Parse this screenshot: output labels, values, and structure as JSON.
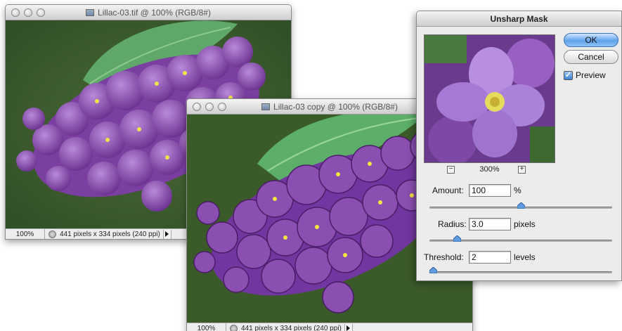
{
  "window1": {
    "title": "Lillac-03.tif @ 100% (RGB/8#)",
    "zoom": "100%",
    "info": "441 pixels x 334 pixels (240 ppi)"
  },
  "window2": {
    "title": "Lillac-03 copy @ 100% (RGB/8#)",
    "zoom": "100%",
    "info": "441 pixels x 334 pixels (240 ppi)"
  },
  "dialog": {
    "title": "Unsharp Mask",
    "ok_label": "OK",
    "cancel_label": "Cancel",
    "preview_label": "Preview",
    "preview_checked": true,
    "zoom_minus": "−",
    "zoom_value": "300%",
    "zoom_plus": "+",
    "amount": {
      "label": "Amount:",
      "value": "100",
      "unit": "%",
      "slider_fraction": 0.5
    },
    "radius": {
      "label": "Radius:",
      "value": "3.0",
      "unit": "pixels",
      "slider_fraction": 0.15
    },
    "threshold": {
      "label": "Threshold:",
      "value": "2",
      "unit": "levels",
      "slider_fraction": 0.0
    }
  },
  "colors": {
    "accent": "#3c84d8",
    "lilac": "#8a4fb0",
    "leaf": "#4f9a5a",
    "background_green": "#3f5f2f"
  }
}
